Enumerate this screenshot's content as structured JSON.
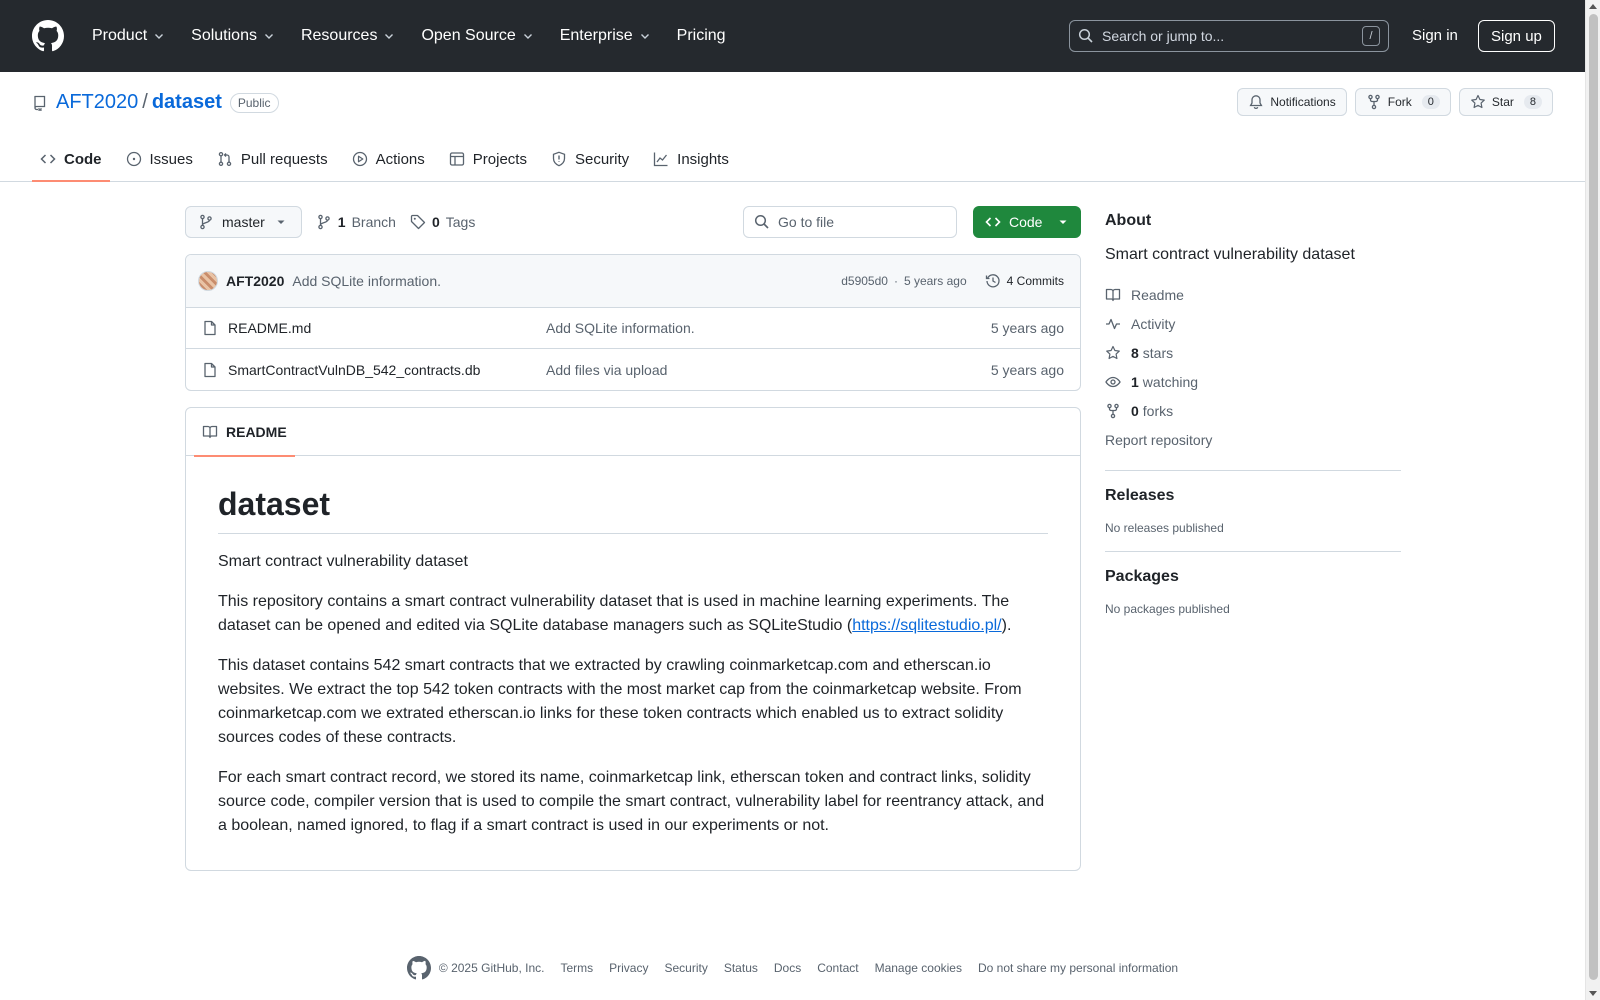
{
  "header": {
    "nav": [
      "Product",
      "Solutions",
      "Resources",
      "Open Source",
      "Enterprise",
      "Pricing"
    ],
    "search_placeholder": "Search or jump to...",
    "search_key": "/",
    "sign_in": "Sign in",
    "sign_up": "Sign up"
  },
  "repo": {
    "owner": "AFT2020",
    "separator": "/",
    "name": "dataset",
    "visibility": "Public",
    "notifications_label": "Notifications",
    "fork_label": "Fork",
    "fork_count": "0",
    "star_label": "Star",
    "star_count": "8"
  },
  "tabs": [
    "Code",
    "Issues",
    "Pull requests",
    "Actions",
    "Projects",
    "Security",
    "Insights"
  ],
  "toolbar": {
    "branch": "master",
    "branch_count": "1",
    "branch_label": "Branch",
    "tag_count": "0",
    "tag_label": "Tags",
    "goto_placeholder": "Go to file",
    "code_label": "Code"
  },
  "commit": {
    "author": "AFT2020",
    "message": "Add SQLite information.",
    "sha": "d5905d0",
    "dot": "·",
    "time": "5 years ago",
    "commits_label": "4 Commits"
  },
  "files": [
    {
      "name": "README.md",
      "message": "Add SQLite information.",
      "date": "5 years ago"
    },
    {
      "name": "SmartContractVulnDB_542_contracts.db",
      "message": "Add files via upload",
      "date": "5 years ago"
    }
  ],
  "readme": {
    "tab_label": "README",
    "title": "dataset",
    "p1": "Smart contract vulnerability dataset",
    "p2_text": "This repository contains a smart contract vulnerability dataset that is used in machine learning experiments. The dataset can be opened and edited via SQLite database managers such as SQLiteStudio (",
    "p2_link": "https://sqlitestudio.pl/",
    "p2_end": ").",
    "p3": "This dataset contains 542 smart contracts that we extracted by crawling coinmarketcap.com and etherscan.io websites. We extract the top 542 token contracts with the most market cap from the coinmarketcap website. From coinmarketcap.com we extrated etherscan.io links for these token contracts which enabled us to extract solidity sources codes of these contracts.",
    "p4": "For each smart contract record, we stored its name, coinmarketcap link, etherscan token and contract links, solidity source code, compiler version that is used to compile the smart contract, vulnerability label for reentrancy attack, and a boolean, named ignored, to flag if a smart contract is used in our experiments or not."
  },
  "sidebar": {
    "about_title": "About",
    "description": "Smart contract vulnerability dataset",
    "readme": "Readme",
    "activity": "Activity",
    "stars_count": "8",
    "stars_label": "stars",
    "watching_count": "1",
    "watching_label": "watching",
    "forks_count": "0",
    "forks_label": "forks",
    "report": "Report repository",
    "releases_title": "Releases",
    "releases_text": "No releases published",
    "packages_title": "Packages",
    "packages_text": "No packages published"
  },
  "footer": {
    "copyright": "© 2025 GitHub, Inc.",
    "links": [
      "Terms",
      "Privacy",
      "Security",
      "Status",
      "Docs",
      "Contact",
      "Manage cookies",
      "Do not share my personal information"
    ]
  },
  "colors": {
    "header_bg": "#25292e",
    "accent_link": "#0969da",
    "code_button": "#1f883d",
    "active_tab_underline": "#fd8c73"
  }
}
